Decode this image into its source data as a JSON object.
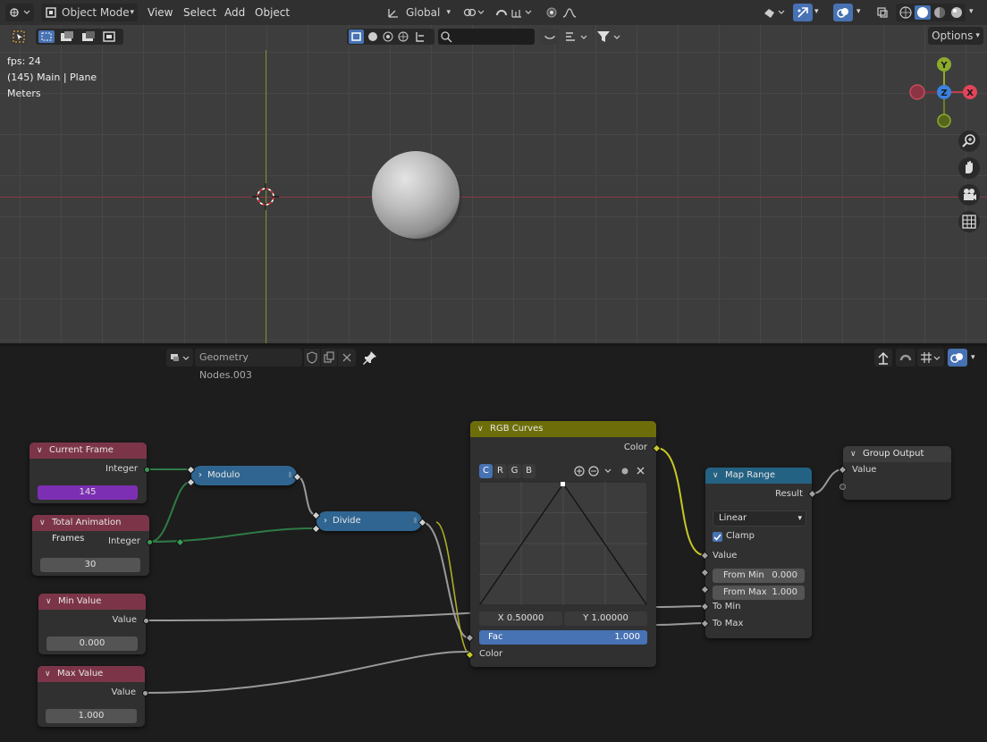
{
  "viewport": {
    "header": {
      "mode": "Object Mode",
      "menu": [
        "View",
        "Select",
        "Add",
        "Object"
      ],
      "transform_orientation": "Global",
      "options": "Options"
    },
    "overlay": {
      "fps": "fps: 24",
      "context": "(145) Main | Plane",
      "units": "Meters"
    },
    "gizmo": {
      "y": "Y",
      "z": "Z",
      "x": "X"
    }
  },
  "node_editor": {
    "header": {
      "tree_name": "Geometry Nodes.003"
    },
    "nodes": {
      "current_frame": {
        "title": "Current Frame",
        "output": "Integer",
        "value": "145"
      },
      "total_frames": {
        "title": "Total Animation Frames",
        "output": "Integer",
        "value": "30"
      },
      "min_value": {
        "title": "Min Value",
        "output": "Value",
        "value": "0.000"
      },
      "max_value": {
        "title": "Max Value",
        "output": "Value",
        "value": "1.000"
      },
      "modulo": {
        "title": "Modulo"
      },
      "divide": {
        "title": "Divide"
      },
      "rgb_curves": {
        "title": "RGB Curves",
        "output": "Color",
        "channels": [
          "C",
          "R",
          "G",
          "B"
        ],
        "x": "X 0.50000",
        "y": "Y 1.00000",
        "fac_label": "Fac",
        "fac_value": "1.000",
        "color_input": "Color"
      },
      "map_range": {
        "title": "Map Range",
        "output": "Result",
        "interpolation": "Linear",
        "clamp": "Clamp",
        "value": "Value",
        "from_min_label": "From Min",
        "from_min": "0.000",
        "from_max_label": "From Max",
        "from_max": "1.000",
        "to_min": "To Min",
        "to_max": "To Max"
      },
      "group_output": {
        "title": "Group Output",
        "input": "Value"
      }
    }
  },
  "colors": {
    "int_socket": "#3b9a55",
    "color_socket": "#c7c729",
    "input_header": "#7c3548",
    "color_header": "#6d6e09",
    "convert_header": "#246283",
    "accent": "#4772b3",
    "frame_field": "#7d2fb4"
  }
}
